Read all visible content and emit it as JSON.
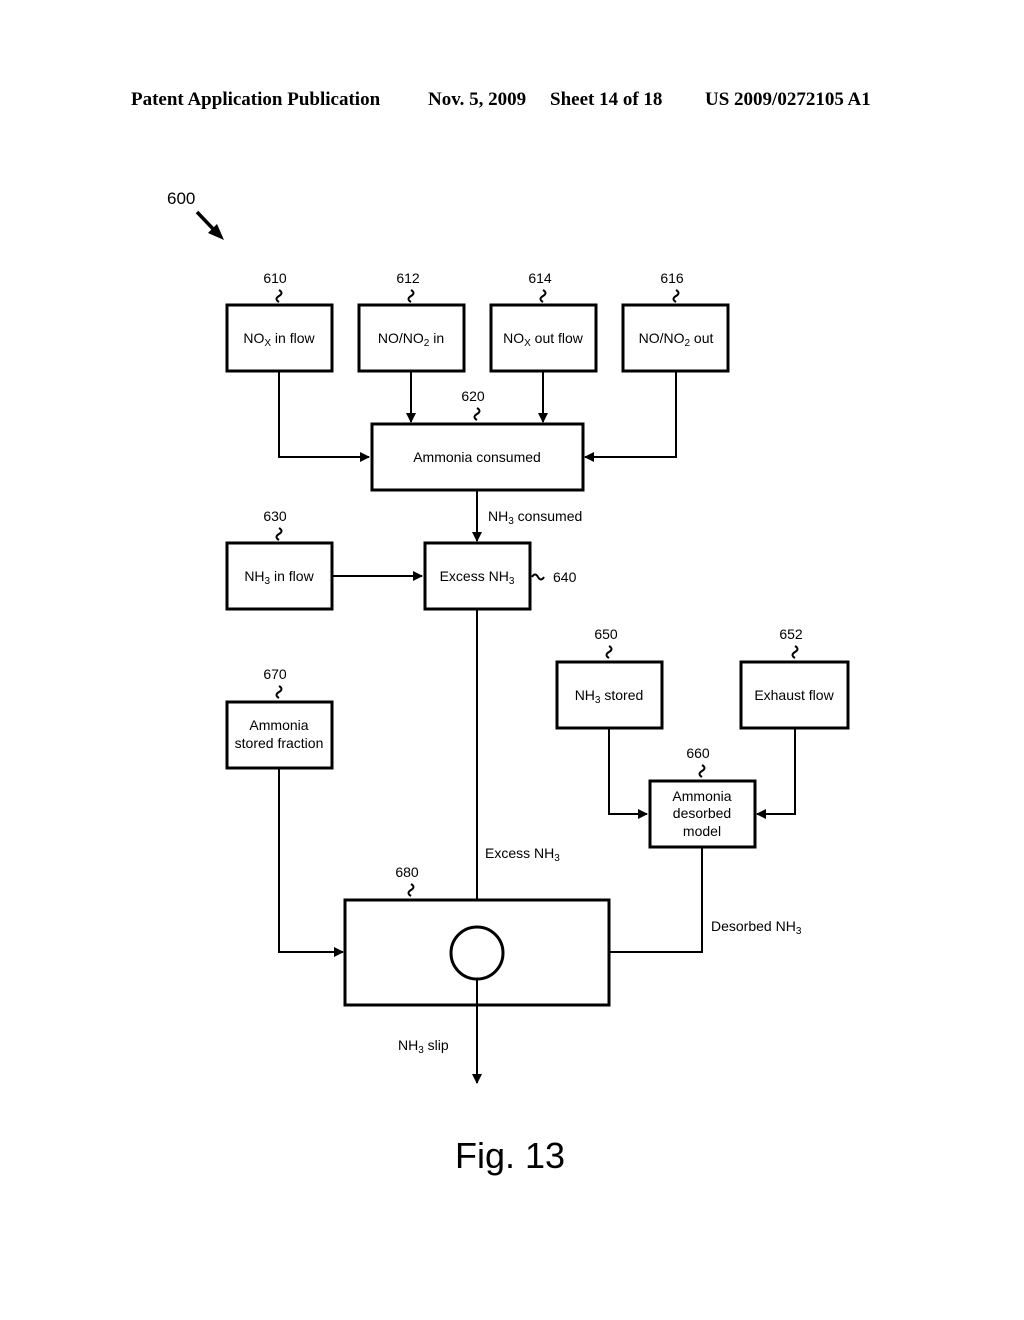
{
  "header": {
    "publication": "Patent Application Publication",
    "date": "Nov. 5, 2009",
    "sheet": "Sheet 14 of 18",
    "number": "US 2009/0272105 A1"
  },
  "figure": {
    "label": "Fig. 13",
    "ref": "600"
  },
  "blocks": {
    "b610": {
      "ref": "610",
      "pre": "NO",
      "sub": "X",
      "post": " in flow"
    },
    "b612": {
      "ref": "612",
      "pre": "NO/NO",
      "sub": "2",
      "post": " in"
    },
    "b614": {
      "ref": "614",
      "pre": "NO",
      "sub": "X",
      "post": " out flow"
    },
    "b616": {
      "ref": "616",
      "pre": "NO/NO",
      "sub": "2",
      "post": " out"
    },
    "b620": {
      "ref": "620",
      "text": "Ammonia consumed"
    },
    "b630": {
      "ref": "630",
      "pre": "NH",
      "sub": "3",
      "post": " in flow"
    },
    "b640": {
      "ref": "640",
      "pre": "Excess NH",
      "sub": "3",
      "post": ""
    },
    "b650": {
      "ref": "650",
      "pre": "NH",
      "sub": "3",
      "post": " stored"
    },
    "b652": {
      "ref": "652",
      "text": "Exhaust flow"
    },
    "b660": {
      "ref": "660",
      "line1": "Ammonia",
      "line2": "desorbed",
      "line3": "model"
    },
    "b670": {
      "ref": "670",
      "line1": "Ammonia",
      "line2": "stored fraction"
    },
    "b680": {
      "ref": "680"
    }
  },
  "signals": {
    "nh3_consumed": {
      "pre": "NH",
      "sub": "3",
      "post": " consumed"
    },
    "excess_nh3": {
      "pre": "Excess NH",
      "sub": "3",
      "post": ""
    },
    "desorbed_nh3": {
      "pre": "Desorbed NH",
      "sub": "3",
      "post": ""
    },
    "nh3_slip": {
      "pre": "NH",
      "sub": "3",
      "post": " slip"
    }
  }
}
